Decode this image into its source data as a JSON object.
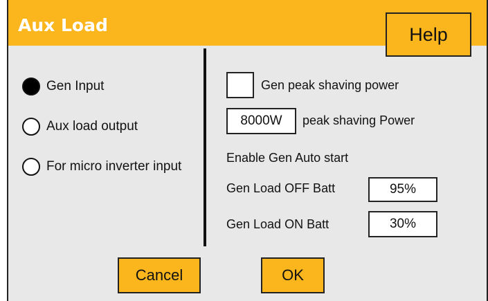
{
  "window": {
    "title": "Aux Load"
  },
  "help": {
    "label": "Help"
  },
  "modes": [
    {
      "label": "Gen Input",
      "checked": true
    },
    {
      "label": "Aux load output",
      "checked": false
    },
    {
      "label": "For micro inverter input",
      "checked": false
    }
  ],
  "gen_peak_shaving": {
    "label": "Gen peak shaving power",
    "checked": false
  },
  "peak_shaving_power": {
    "value": "8000W",
    "label": "peak shaving Power"
  },
  "auto_start": {
    "label": "Enable Gen Auto start"
  },
  "gen_load_off": {
    "label": "Gen Load OFF Batt",
    "value": "95%"
  },
  "gen_load_on": {
    "label": "Gen Load ON Batt",
    "value": "30%"
  },
  "actions": {
    "cancel": "Cancel",
    "ok": "OK"
  },
  "colors": {
    "accent": "#fcb61d",
    "background": "#e8e8e8"
  }
}
